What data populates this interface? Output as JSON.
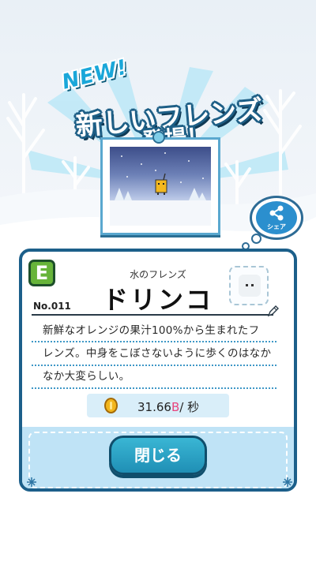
{
  "popup": {
    "new_badge": "NEW!",
    "title_line1": "新しいフレンズ",
    "title_line2": "登場！"
  },
  "share_button": {
    "label": "シェア"
  },
  "friend": {
    "rank": "E",
    "element": "水のフレンズ",
    "name": "ドリンコ",
    "number": "No.011",
    "description_lines": [
      "新鮮なオレンジの果汁100%から生まれたフ",
      "レンズ。中身をこぼさないように歩くのはなか",
      "なか大変らしい。"
    ],
    "rate_value": "31.66",
    "rate_unit": "B",
    "rate_suffix": "/ 秒"
  },
  "close_button": {
    "label": "閉じる"
  },
  "colors": {
    "accent": "#1c5f8a",
    "rank_badge": "#67b43a",
    "rate_unit": "#e8447d",
    "button": "#2aa6cc"
  }
}
